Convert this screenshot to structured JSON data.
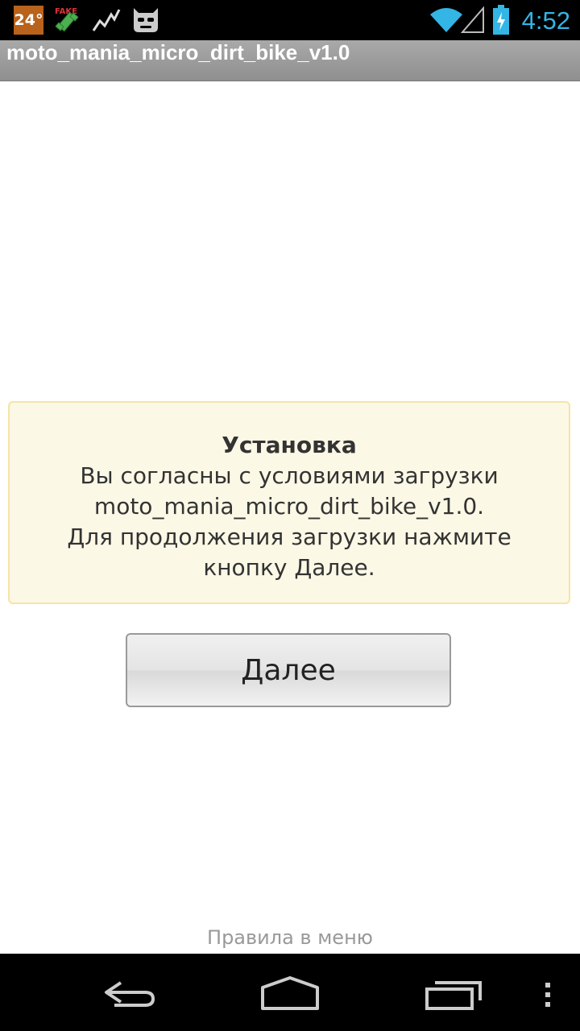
{
  "status_bar": {
    "temperature": "24°",
    "clock": "4:52",
    "icons": [
      "temperature-badge",
      "fake-gps-icon",
      "activity-chart-icon",
      "cyanogen-mascot-icon",
      "wifi-icon",
      "cell-signal-icon",
      "battery-charging-icon"
    ],
    "clock_color": "#33b5e5"
  },
  "title_bar": {
    "title": "moto_mania_micro_dirt_bike_v1.0"
  },
  "info_box": {
    "heading": "Установка",
    "lines": [
      "Вы согласны с условиями загрузки",
      "moto_mania_micro_dirt_bike_v1.0.",
      "Для продолжения загрузки нажмите",
      "кнопку Далее."
    ]
  },
  "next_button": {
    "label": "Далее"
  },
  "footer": {
    "rules_link": "Правила в меню"
  },
  "nav_bar": {
    "buttons": [
      "back-icon",
      "home-icon",
      "recents-icon",
      "menu-icon"
    ]
  },
  "colors": {
    "info_bg": "#fcf8e6",
    "info_border": "#f6e4a6",
    "title_bar": "#9a9a9a"
  }
}
